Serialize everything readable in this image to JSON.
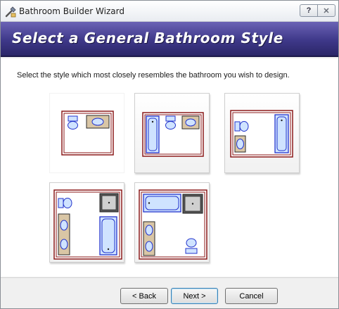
{
  "window": {
    "title": "Bathroom Builder Wizard",
    "help_glyph": "?",
    "close_glyph": "✕",
    "app_icon": "wrench-house-icon"
  },
  "banner": {
    "title": "Select a General Bathroom Style"
  },
  "content": {
    "instructions": "Select the style which most closely resembles the bathroom you wish to design."
  },
  "styles": [
    {
      "id": "style-1",
      "fixtures": "toilet and vanity",
      "selected": true
    },
    {
      "id": "style-2",
      "fixtures": "tub, toilet and vanity",
      "selected": false
    },
    {
      "id": "style-3",
      "fixtures": "toilet, sink and tub",
      "selected": false
    },
    {
      "id": "style-4",
      "fixtures": "toilet, double vanity, shower and tub",
      "selected": false
    },
    {
      "id": "style-5",
      "fixtures": "tub, shower, double vanity and toilet",
      "selected": false
    }
  ],
  "buttons": {
    "back": "< Back",
    "next": "Next >",
    "cancel": "Cancel"
  },
  "colors": {
    "banner": "#3e3889",
    "wall": "#8b1a1a",
    "fixture_fill": "#cfe3ff",
    "fixture_stroke": "#2233cc",
    "vanity_fill": "#d9c6a5"
  }
}
